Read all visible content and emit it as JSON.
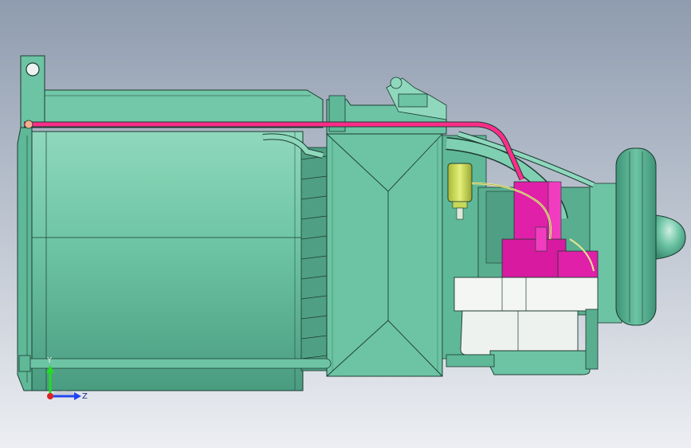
{
  "viewport": {
    "background_top": "#8f9caf",
    "background_bottom": "#eceef2"
  },
  "colors": {
    "body_green": "#6cc4a4",
    "body_green_dark": "#3e8e74",
    "body_green_light": "#8fd8bd",
    "outline": "#1c3a30",
    "pipe_magenta": "#ff2d8a",
    "part_magenta": "#e020a8",
    "filter_yellow": "#c8d858",
    "tank_white": "#f4f6f4",
    "flywheel_green": "#4fae8e"
  },
  "triad": {
    "y_label": "Y",
    "z_label": "Z",
    "y_color": "#22dd22",
    "z_color": "#2244ee",
    "x_color": "#dd2222"
  },
  "icons": {
    "triad": "coordinate-triad-icon"
  }
}
